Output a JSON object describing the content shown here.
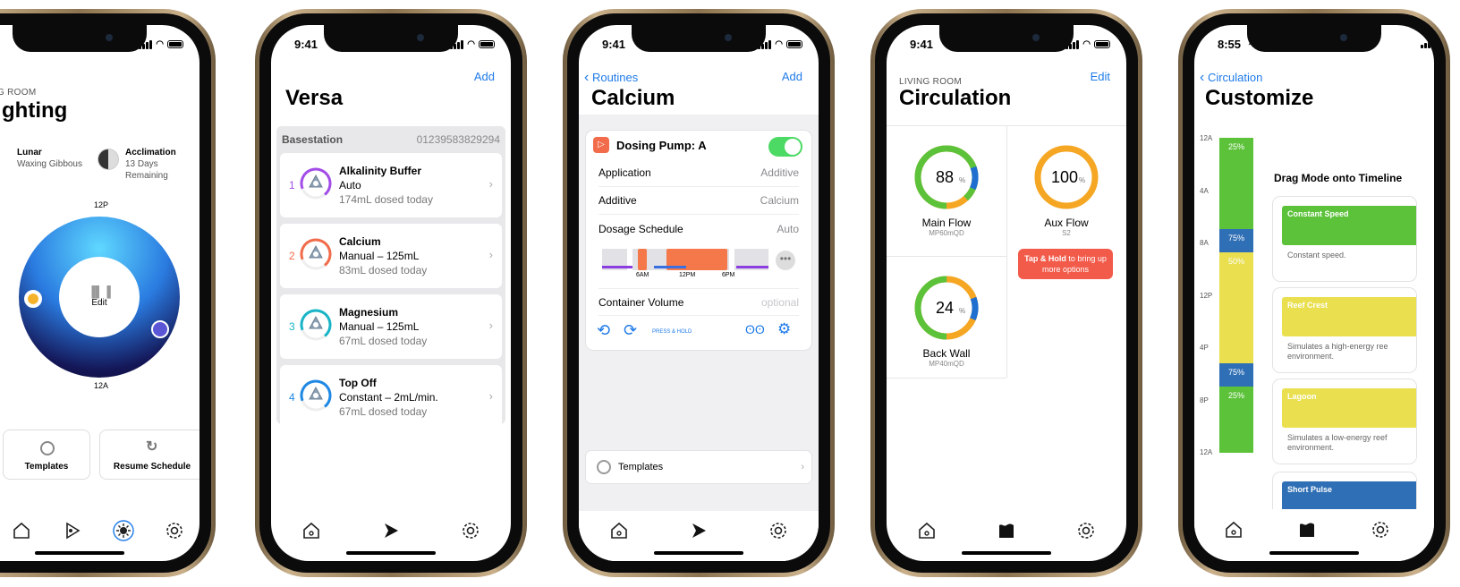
{
  "status": {
    "time": "9:41",
    "time_alt": "8:55"
  },
  "lighting": {
    "room": "G ROOM",
    "title": "ghting",
    "lunar_label": "Lunar",
    "lunar_value": "Waxing Gibbous",
    "accl_label": "Acclimation",
    "accl_value": "13 Days Remaining",
    "dial_top": "12P",
    "dial_bottom": "12A",
    "dial_center": "Edit",
    "templates": "Templates",
    "resume": "Resume Schedule"
  },
  "versa": {
    "add": "Add",
    "title": "Versa",
    "base_label": "Basestation",
    "base_id": "01239583829294",
    "pumps": [
      {
        "num": "1",
        "name": "Alkalinity Buffer",
        "mode": "Auto",
        "dosed": "174mL dosed today",
        "color": "#a34de8"
      },
      {
        "num": "2",
        "name": "Calcium",
        "mode": "Manual – 125mL",
        "dosed": "83mL dosed today",
        "color": "#f26b4a"
      },
      {
        "num": "3",
        "name": "Magnesium",
        "mode": "Manual – 125mL",
        "dosed": "67mL dosed today",
        "color": "#19b4c7"
      },
      {
        "num": "4",
        "name": "Top Off",
        "mode": "Constant – 2mL/min.",
        "dosed": "67mL dosed today",
        "color": "#1e88e5"
      }
    ]
  },
  "calcium": {
    "back": "Routines",
    "add": "Add",
    "title": "Calcium",
    "pump": "Dosing Pump: A",
    "app_label": "Application",
    "app_value": "Additive",
    "add_label": "Additive",
    "add_value": "Calcium",
    "sched_label": "Dosage Schedule",
    "sched_value": "Auto",
    "t6": "6AM",
    "t12": "12PM",
    "t18": "6PM",
    "vol_label": "Container Volume",
    "vol_value": "optional",
    "press_hold": "PRESS & HOLD",
    "templates": "Templates"
  },
  "circulation": {
    "room": "LIVING ROOM",
    "edit": "Edit",
    "title": "Circulation",
    "gauges": [
      {
        "value": "88",
        "unit": "%",
        "name": "Main Flow",
        "model": "MP60mQD",
        "pct": 0.88
      },
      {
        "value": "100",
        "unit": "%",
        "name": "Aux Flow",
        "model": "S2",
        "pct": 1.0
      },
      {
        "value": "24",
        "unit": "%",
        "name": "Back Wall",
        "model": "MP40mQD",
        "pct": 0.24
      }
    ],
    "tip_bold": "Tap & Hold",
    "tip_rest": "to bring up more options"
  },
  "customize": {
    "back": "Circulation",
    "title": "Customize",
    "drag": "Drag Mode onto Timeline",
    "ticks": [
      "12A",
      "4A",
      "8A",
      "12P",
      "4P",
      "8P",
      "12A"
    ],
    "segments": [
      {
        "label": "25%",
        "color": "#5cc23a"
      },
      {
        "label": "75%",
        "color": "#2f6fb5"
      },
      {
        "label": "50%",
        "color": "#e9df4f"
      },
      {
        "label": "75%",
        "color": "#2f6fb5"
      },
      {
        "label": "25%",
        "color": "#5cc23a"
      }
    ],
    "modes": [
      {
        "name": "Constant Speed",
        "desc": "Constant speed.",
        "color": "#5cc23a"
      },
      {
        "name": "Reef Crest",
        "desc": "Simulates a high-energy ree environment.",
        "color": "#e9df4f"
      },
      {
        "name": "Lagoon",
        "desc": "Simulates a low-energy reef environment.",
        "color": "#e9df4f"
      },
      {
        "name": "Short Pulse",
        "desc": "",
        "color": "#2f6fb5"
      }
    ]
  },
  "colors": {
    "accent": "#1e7ae8",
    "green": "#4cd964",
    "orange": "#f5a623"
  }
}
